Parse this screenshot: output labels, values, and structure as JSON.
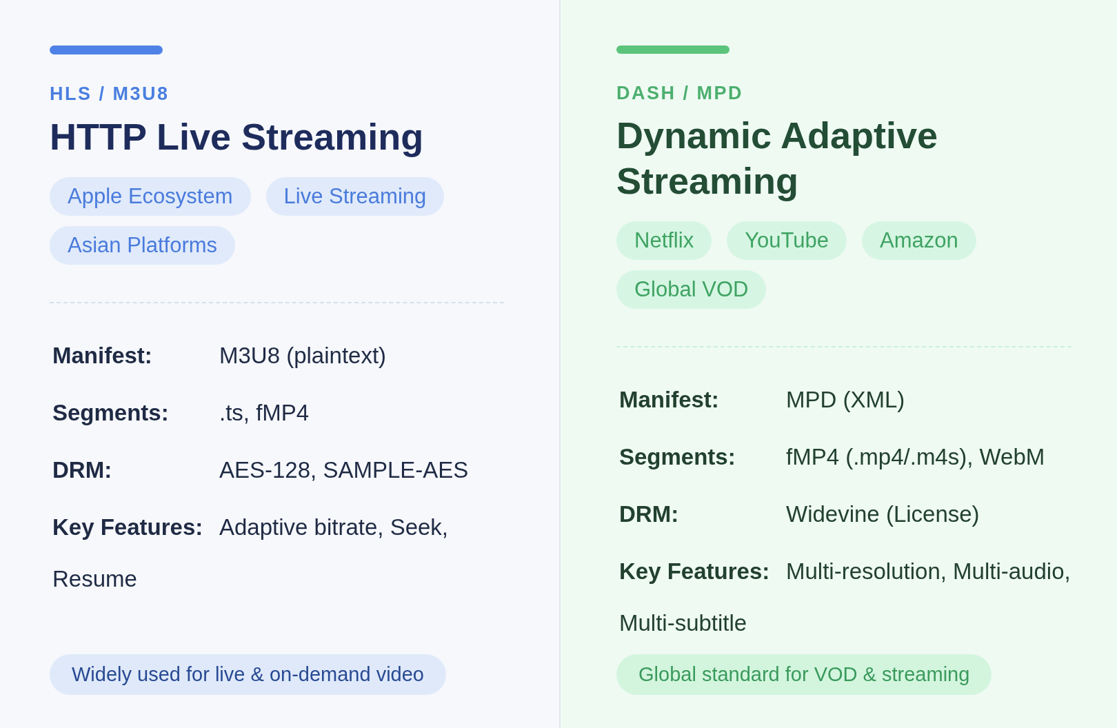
{
  "panels": [
    {
      "kind": "blue",
      "eyebrow": "HLS / M3U8",
      "title": "HTTP Live Streaming",
      "tags": [
        "Apple Ecosystem",
        "Live Streaming",
        "Asian Platforms"
      ],
      "specs": [
        {
          "label": "Manifest:",
          "value": "M3U8 (plaintext)"
        },
        {
          "label": "Segments:",
          "value": ".ts, fMP4"
        },
        {
          "label": "DRM:",
          "value": "AES-128, SAMPLE-AES"
        },
        {
          "label": "Key Features:",
          "value": "Adaptive bitrate, Seek, Resume"
        }
      ],
      "footer": "Widely used for live & on-demand video"
    },
    {
      "kind": "green",
      "eyebrow": "DASH / MPD",
      "title": "Dynamic Adaptive Streaming",
      "tags": [
        "Netflix",
        "YouTube",
        "Amazon",
        "Global VOD"
      ],
      "specs": [
        {
          "label": "Manifest:",
          "value": "MPD (XML)"
        },
        {
          "label": "Segments:",
          "value": "fMP4 (.mp4/.m4s), WebM"
        },
        {
          "label": "DRM:",
          "value": "Widevine (License)"
        },
        {
          "label": "Key Features:",
          "value": "Multi-resolution, Multi-audio, Multi-subtitle"
        }
      ],
      "footer": "Global standard for VOD & streaming"
    }
  ]
}
